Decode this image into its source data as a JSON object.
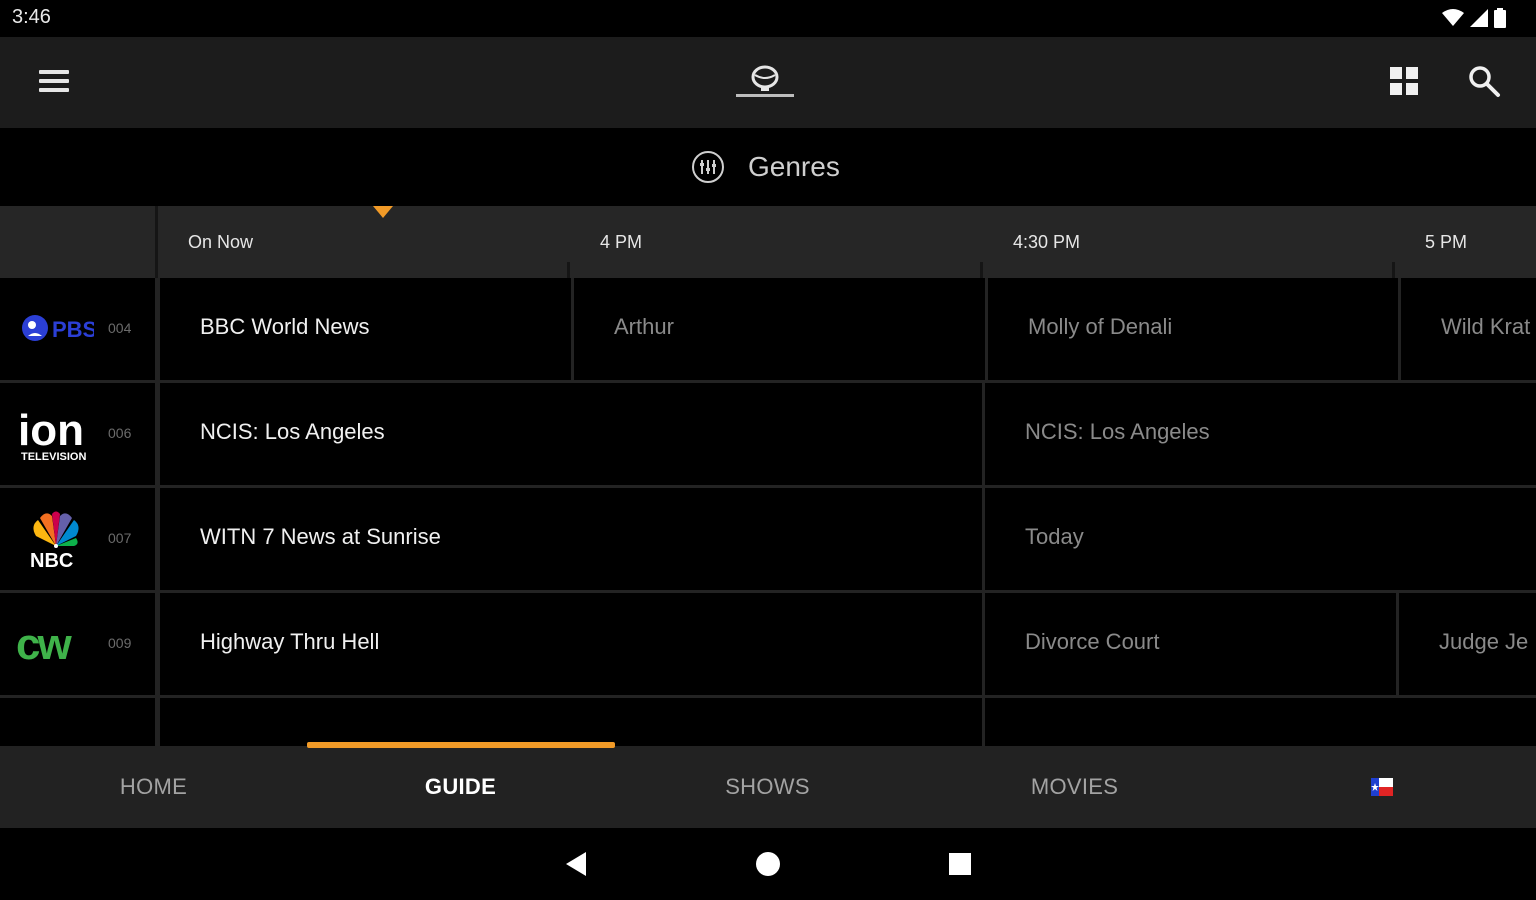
{
  "status_bar": {
    "time": "3:46"
  },
  "header": {
    "menu_icon": "hamburger-menu-icon",
    "logo_icon": "antenna-app-logo",
    "grid_icon": "grid-view-icon",
    "search_icon": "search-icon"
  },
  "genres": {
    "label": "Genres",
    "icon": "genres-filter-icon"
  },
  "time_header": {
    "slots": [
      "On Now",
      "4 PM",
      "4:30 PM",
      "5 PM"
    ]
  },
  "channels": [
    {
      "logo": "PBS",
      "number": "004",
      "programs": [
        {
          "title": "BBC World News",
          "state": "current"
        },
        {
          "title": "Arthur",
          "state": "future"
        },
        {
          "title": "Molly of Denali",
          "state": "future"
        },
        {
          "title": "Wild Krat",
          "state": "future"
        }
      ]
    },
    {
      "logo": "ion",
      "logo_sub": "TELEVISION",
      "number": "006",
      "programs": [
        {
          "title": "NCIS: Los Angeles",
          "state": "current"
        },
        {
          "title": "NCIS: Los Angeles",
          "state": "future"
        }
      ]
    },
    {
      "logo": "NBC",
      "number": "007",
      "programs": [
        {
          "title": "WITN 7 News at Sunrise",
          "state": "current"
        },
        {
          "title": "Today",
          "state": "future"
        }
      ]
    },
    {
      "logo": "cw",
      "number": "009",
      "programs": [
        {
          "title": "Highway Thru Hell",
          "state": "current"
        },
        {
          "title": "Divorce Court",
          "state": "future"
        },
        {
          "title": "Judge Je",
          "state": "future"
        }
      ]
    }
  ],
  "bottom_nav": {
    "items": [
      "HOME",
      "GUIDE",
      "SHOWS",
      "MOVIES"
    ],
    "active": "GUIDE",
    "flag_icon": "texas-flag-icon"
  },
  "colors": {
    "accent": "#f19a27",
    "pbs_blue": "#2b3fd6",
    "cw_green": "#3fb34a",
    "app_bar": "#1c1c1c",
    "nav_bar": "#222222"
  }
}
